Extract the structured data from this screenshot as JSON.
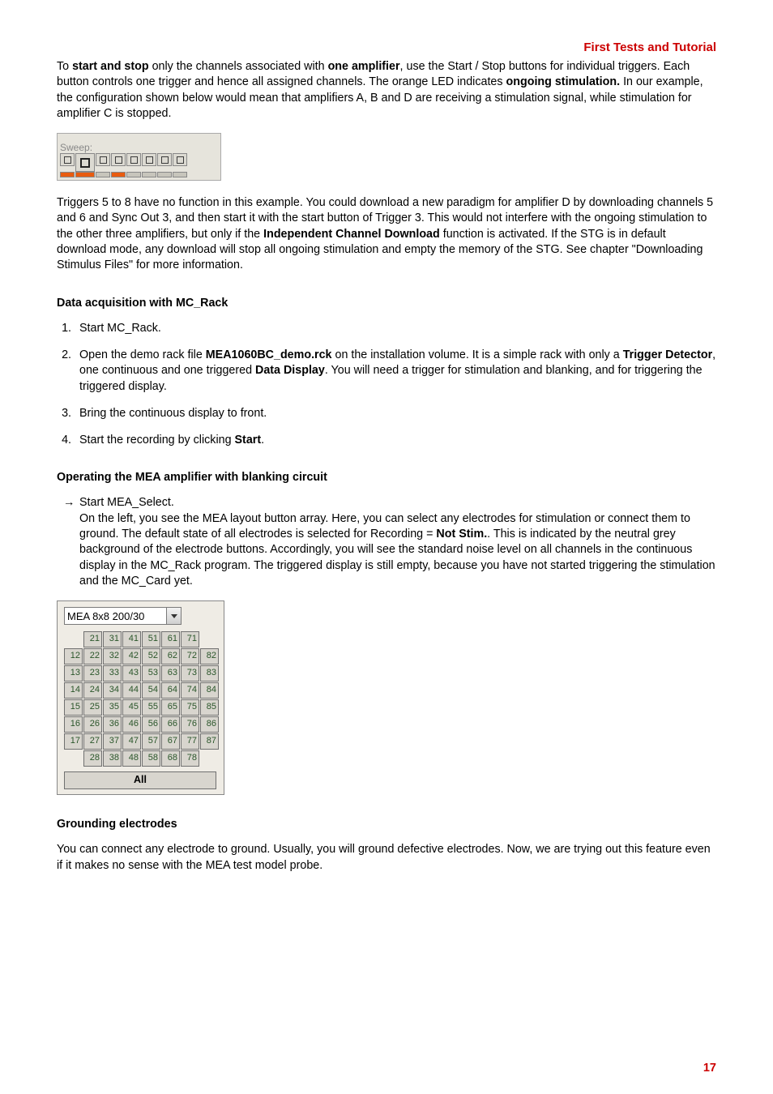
{
  "header": {
    "title": "First Tests and Tutorial"
  },
  "para1": {
    "t1": "To ",
    "b1": "start and stop",
    "t2": " only the channels associated with ",
    "b2": "one amplifier",
    "t3": ", use the Start / Stop buttons for individual triggers. Each button controls one trigger and hence all assigned channels. The orange LED indicates ",
    "b3": "ongoing stimulation.",
    "t4": " In our example, the configuration shown below would mean that amplifiers A, B and D are receiving a stimulation signal, while stimulation for amplifier C is stopped."
  },
  "sweep": {
    "label": "Sweep:",
    "leds": [
      "on",
      "on",
      "off",
      "on",
      "off",
      "off",
      "off",
      "off"
    ]
  },
  "para2": {
    "t1": "Triggers 5 to 8 have no function in this example. You could download a new paradigm for amplifier D by downloading channels 5 and 6 and Sync Out 3, and then start it with the start button of Trigger 3. This would not interfere with the ongoing stimulation to the other three amplifiers, but only if the ",
    "b1": "Independent Channel Download",
    "t2": " function is activated. If the STG is in default download mode, any download will stop all ongoing stimulation and empty the memory of the STG. See chapter \"Downloading Stimulus Files\" for more information."
  },
  "headings": {
    "dacq": "Data acquisition with MC_Rack",
    "operating": "Operating the MEA amplifier with blanking circuit",
    "grounding": "Grounding electrodes"
  },
  "steps": {
    "s1": "Start MC_Rack.",
    "s2_t1": "Open the demo rack file ",
    "s2_b1": "MEA1060BC_demo.rck",
    "s2_t2": " on the installation volume. It is a simple rack with only a ",
    "s2_b2": "Trigger Detector",
    "s2_t3": ", one continuous and one triggered ",
    "s2_b3": "Data Display",
    "s2_t4": ". You will need a trigger for stimulation and blanking, and for triggering the triggered display.",
    "s3": "Bring the continuous display to front.",
    "s4_t1": "Start the recording by clicking ",
    "s4_b1": "Start",
    "s4_t2": "."
  },
  "arrow": {
    "sym": "→",
    "line1": "Start MEA_Select.",
    "rest_t1": "On the left, you see the MEA layout button array. Here, you can select any electrodes for stimulation or connect them to ground. The default state of all electrodes is selected for Recording = ",
    "rest_b1": "Not Stim.",
    "rest_t2": ". This is indicated by the neutral grey background of the electrode buttons. Accordingly, you will see the standard noise level on all channels in the continuous display in the MC_Rack program. The triggered display is still empty, because you have not started triggering the stimulation and the MC_Card yet."
  },
  "mea": {
    "selected": "MEA 8x8 200/30",
    "rows": [
      [
        "",
        "21",
        "31",
        "41",
        "51",
        "61",
        "71",
        ""
      ],
      [
        "12",
        "22",
        "32",
        "42",
        "52",
        "62",
        "72",
        "82"
      ],
      [
        "13",
        "23",
        "33",
        "43",
        "53",
        "63",
        "73",
        "83"
      ],
      [
        "14",
        "24",
        "34",
        "44",
        "54",
        "64",
        "74",
        "84"
      ],
      [
        "15",
        "25",
        "35",
        "45",
        "55",
        "65",
        "75",
        "85"
      ],
      [
        "16",
        "26",
        "36",
        "46",
        "56",
        "66",
        "76",
        "86"
      ],
      [
        "17",
        "27",
        "37",
        "47",
        "57",
        "67",
        "77",
        "87"
      ],
      [
        "",
        "28",
        "38",
        "48",
        "58",
        "68",
        "78",
        ""
      ]
    ],
    "all": "All"
  },
  "grounding_text": "You can connect any electrode to ground. Usually, you will ground defective electrodes. Now, we are trying out this feature even if it makes no sense with the MEA test model probe.",
  "page_number": "17"
}
